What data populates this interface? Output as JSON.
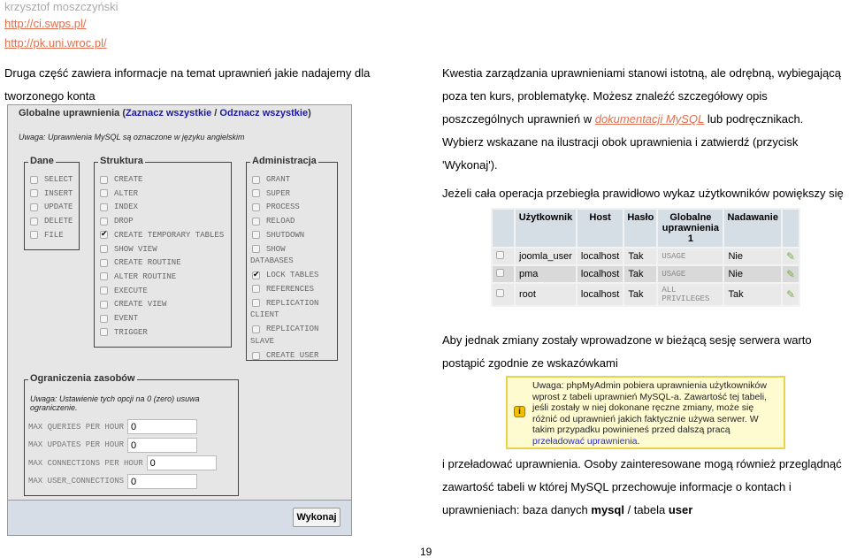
{
  "header": {
    "author": "krzysztof moszczyński",
    "links": [
      "http://ci.swps.pl/",
      "http://pk.uni.wroc.pl/"
    ]
  },
  "left_text": [
    "Druga część zawiera informacje na temat uprawnień jakie nadajemy dla",
    "tworzonego konta"
  ],
  "privileges": {
    "legend": "Globalne uprawnienia (",
    "select_all": "Zaznacz wszystkie",
    "sep": " / ",
    "deselect_all": "Odznacz wszystkie",
    "legend_end": ")",
    "note": "Uwaga: Uprawnienia MySQL są oznaczone w języku angielskim",
    "groups": [
      {
        "title": "Dane",
        "items": [
          {
            "label": "SELECT",
            "checked": false
          },
          {
            "label": "INSERT",
            "checked": false
          },
          {
            "label": "UPDATE",
            "checked": false
          },
          {
            "label": "DELETE",
            "checked": false
          },
          {
            "label": "FILE",
            "checked": false
          }
        ]
      },
      {
        "title": "Struktura",
        "items": [
          {
            "label": "CREATE",
            "checked": false
          },
          {
            "label": "ALTER",
            "checked": false
          },
          {
            "label": "INDEX",
            "checked": false
          },
          {
            "label": "DROP",
            "checked": false
          },
          {
            "label": "CREATE TEMPORARY TABLES",
            "checked": true
          },
          {
            "label": "SHOW VIEW",
            "checked": false
          },
          {
            "label": "CREATE ROUTINE",
            "checked": false
          },
          {
            "label": "ALTER ROUTINE",
            "checked": false
          },
          {
            "label": "EXECUTE",
            "checked": false
          },
          {
            "label": "CREATE VIEW",
            "checked": false
          },
          {
            "label": "EVENT",
            "checked": false
          },
          {
            "label": "TRIGGER",
            "checked": false
          }
        ]
      },
      {
        "title": "Administracja",
        "items": [
          {
            "label": "GRANT",
            "checked": false
          },
          {
            "label": "SUPER",
            "checked": false
          },
          {
            "label": "PROCESS",
            "checked": false
          },
          {
            "label": "RELOAD",
            "checked": false
          },
          {
            "label": "SHUTDOWN",
            "checked": false
          },
          {
            "label": "SHOW",
            "checked": false,
            "wrap": "DATABASES"
          },
          {
            "label": "LOCK TABLES",
            "checked": true
          },
          {
            "label": "REFERENCES",
            "checked": false
          },
          {
            "label": "REPLICATION",
            "checked": false,
            "wrap": "CLIENT"
          },
          {
            "label": "REPLICATION",
            "checked": false,
            "wrap": "SLAVE"
          },
          {
            "label": "CREATE USER",
            "checked": false
          }
        ]
      }
    ],
    "limits": {
      "title": "Ograniczenia zasobów",
      "note": "Uwaga: Ustawienie tych opcji na 0 (zero) usuwa ograniczenie.",
      "fields": [
        {
          "label": "MAX QUERIES PER HOUR",
          "value": "0"
        },
        {
          "label": "MAX UPDATES PER HOUR",
          "value": "0"
        },
        {
          "label": "MAX CONNECTIONS PER HOUR",
          "value": "0"
        },
        {
          "label": "MAX USER_CONNECTIONS",
          "value": "0"
        }
      ]
    },
    "submit": "Wykonaj"
  },
  "right_text": {
    "p1": [
      "Kwestia zarządzania uprawnieniami stanowi istotną, ale odrębną, wybiegającą",
      "poza ten kurs, problematykę. Możesz znaleźć szczegółowy opis"
    ],
    "p1_line3_pre": "poszczególnych uprawnień w ",
    "p1_link": "dokumentacji MySQL",
    "p1_line3_post": " lub podręcznikach.",
    "p1_rest": [
      "Wybierz wskazane na ilustracji obok uprawnienia i zatwierdź (przycisk",
      "'Wykonaj')."
    ],
    "p2": "Jeżeli cała operacja przebiegła prawidłowo wykaz użytkowników powiększy się",
    "p3": [
      "Aby jednak zmiany zostały wprowadzone w bieżącą sesję serwera warto",
      "postąpić zgodnie ze wskazówkami"
    ],
    "p4": [
      "i przeładować uprawnienia. Osoby zainteresowane mogą również przeglądnąć",
      "zawartość tabeli w której MySQL przechowuje informacje o kontach i"
    ],
    "p4_last_pre": "uprawnieniach: baza danych ",
    "db": "mysql",
    "p4_sep": " / tabela ",
    "tbl": "user"
  },
  "users_table": {
    "headers": [
      "Użytkownik",
      "Host",
      "Hasło",
      "Globalne uprawnienia 1",
      "Nadawanie"
    ],
    "rows": [
      [
        "joomla_user",
        "localhost",
        "Tak",
        "USAGE",
        "Nie"
      ],
      [
        "pma",
        "localhost",
        "Tak",
        "USAGE",
        "Nie"
      ],
      [
        "root",
        "localhost",
        "Tak",
        "ALL PRIVILEGES",
        "Tak"
      ]
    ]
  },
  "notice": {
    "text": "Uwaga: phpMyAdmin pobiera uprawnienia użytkowników wprost z tabeli uprawnień MySQL-a. Zawartość tej tabeli, jeśli zostały w niej dokonane ręczne zmiany, może się różnić od uprawnień jakich faktycznie używa serwer. W takim przypadku powinieneś przed dalszą pracą ",
    "link": "przeładować uprawnienia",
    "end": "."
  },
  "page_number": "19"
}
